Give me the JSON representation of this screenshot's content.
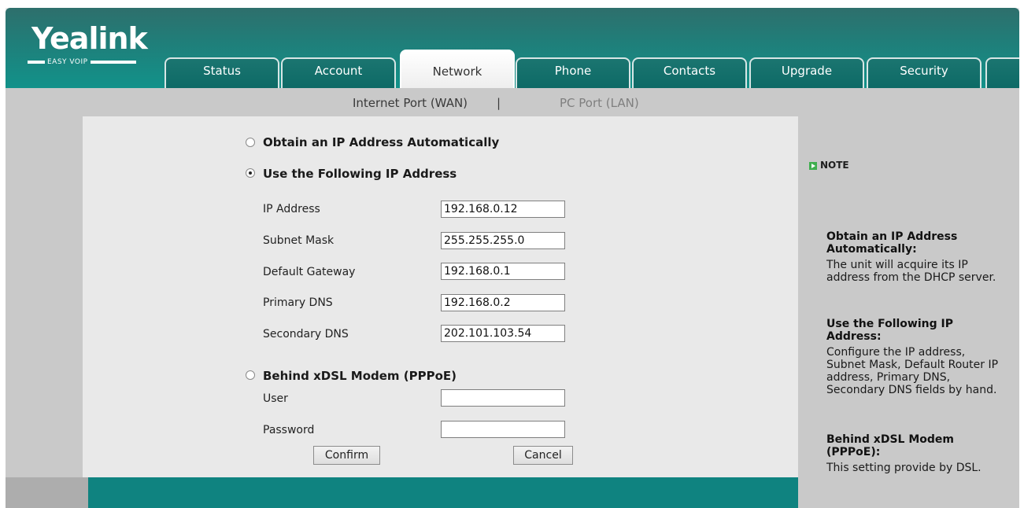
{
  "logo": {
    "brand": "Yealink",
    "tagline": "EASY VOIP"
  },
  "tabs": [
    {
      "label": "Status"
    },
    {
      "label": "Account"
    },
    {
      "label": "Network",
      "active": true
    },
    {
      "label": "Phone"
    },
    {
      "label": "Contacts"
    },
    {
      "label": "Upgrade"
    },
    {
      "label": "Security"
    }
  ],
  "subnav": {
    "wan": "Internet Port (WAN)",
    "separator": "|",
    "lan": "PC Port (LAN)"
  },
  "form": {
    "dhcp_label": "Obtain an IP Address Automatically",
    "static_label": "Use the Following IP Address",
    "pppoe_label": "Behind xDSL Modem (PPPoE)",
    "selected_mode": "static",
    "fields": {
      "ip_label": "IP Address",
      "ip_value": "192.168.0.12",
      "mask_label": "Subnet Mask",
      "mask_value": "255.255.255.0",
      "gateway_label": "Default Gateway",
      "gateway_value": "192.168.0.1",
      "dns1_label": "Primary DNS",
      "dns1_value": "192.168.0.2",
      "dns2_label": "Secondary DNS",
      "dns2_value": "202.101.103.54",
      "user_label": "User",
      "user_value": "",
      "password_label": "Password",
      "password_value": ""
    },
    "confirm_label": "Confirm",
    "cancel_label": "Cancel"
  },
  "note": {
    "title": "NOTE",
    "dhcp_head": "Obtain an IP Address Automatically:",
    "dhcp_body": "The unit will acquire its IP address from the DHCP server.",
    "static_head": "Use the Following IP Address:",
    "static_body": "Configure the IP address, Subnet Mask, Default Router IP address, Primary DNS, Secondary DNS fields by hand.",
    "pppoe_head": "Behind xDSL Modem (PPPoE):",
    "pppoe_body": "This setting provide by DSL."
  },
  "colors": {
    "header_teal": "#12928a",
    "footer_teal": "#0f8380",
    "note_icon": "#3fae4f"
  }
}
